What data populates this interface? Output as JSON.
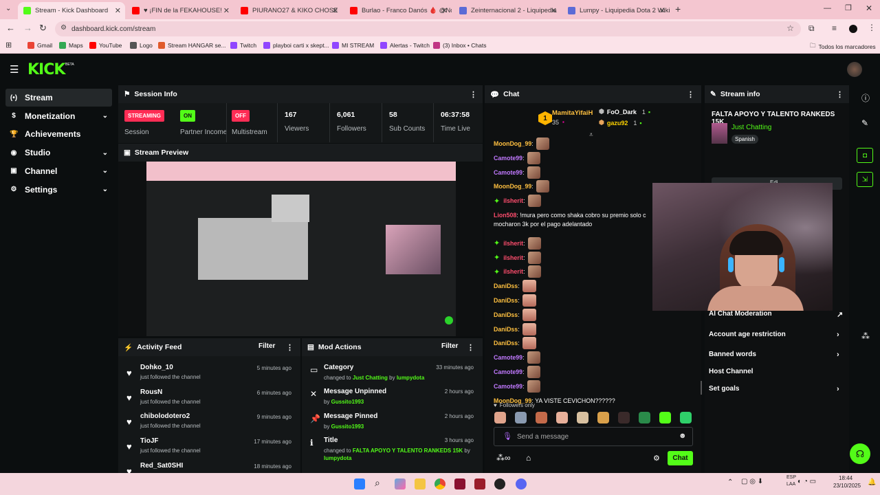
{
  "browser": {
    "tabs": [
      {
        "title": "Stream - Kick Dashboard",
        "color": "#53fc18"
      },
      {
        "title": "♥ ¡FIN de la FEKAHOUSE!",
        "color": "#ff0000"
      },
      {
        "title": "PIURANO27 & KIKO CHOSE",
        "color": "#ff0000"
      },
      {
        "title": "Burlao - Franco Danós 🩸 @Nc",
        "color": "#ff0000"
      },
      {
        "title": "Zeinternacional 2 - Liquipedia",
        "color": "#5b6bd6"
      },
      {
        "title": "Lumpy - Liquipedia Dota 2 Wiki",
        "color": "#5b6bd6"
      }
    ],
    "url": "dashboard.kick.com/stream",
    "bookmarks": [
      {
        "label": "Gmail",
        "color": "#ea4335"
      },
      {
        "label": "Maps",
        "color": "#34a853"
      },
      {
        "label": "YouTube",
        "color": "#ff0000"
      },
      {
        "label": "Logo",
        "color": "#555555"
      },
      {
        "label": "Stream HANGAR se...",
        "color": "#e05a2b"
      },
      {
        "label": "Twitch",
        "color": "#9146ff"
      },
      {
        "label": "playboi carti x skept...",
        "color": "#9146ff"
      },
      {
        "label": "MI STREAM",
        "color": "#9146ff"
      },
      {
        "label": "Alertas - Twitch",
        "color": "#9146ff"
      },
      {
        "label": "(3) Inbox • Chats",
        "color": "#c13584"
      }
    ],
    "all_bookmarks": "Todos los marcadores"
  },
  "brand": {
    "logo": "KICK",
    "beta": "BETA",
    "accent": "#53fc18"
  },
  "sidebar": [
    {
      "label": "Stream",
      "icon": "stream-icon",
      "glyph": "(•)",
      "active": true
    },
    {
      "label": "Monetization",
      "icon": "dollar-icon",
      "glyph": "$",
      "chevron": true
    },
    {
      "label": "Achievements",
      "icon": "trophy-icon",
      "glyph": "🏆"
    },
    {
      "label": "Studio",
      "icon": "studio-icon",
      "glyph": "◉",
      "chevron": true
    },
    {
      "label": "Channel",
      "icon": "channel-icon",
      "glyph": "▣",
      "chevron": true
    },
    {
      "label": "Settings",
      "icon": "gear-icon",
      "glyph": "⚙",
      "chevron": true
    }
  ],
  "session_info": {
    "title": "Session Info",
    "stats": [
      {
        "value": "STREAMING",
        "label": "Session",
        "style": "pill",
        "color": "#ff2d55"
      },
      {
        "value": "ON",
        "label": "Partner Income",
        "style": "pill",
        "color": "#53fc18"
      },
      {
        "value": "OFF",
        "label": "Multistream",
        "style": "pill",
        "color": "#ff2d55"
      },
      {
        "value": "167",
        "label": "Viewers"
      },
      {
        "value": "6,061",
        "label": "Followers"
      },
      {
        "value": "58",
        "label": "Sub Counts"
      },
      {
        "value": "06:37:58",
        "label": "Time Live"
      }
    ]
  },
  "stream_preview": {
    "title": "Stream Preview"
  },
  "activity_feed": {
    "title": "Activity Feed",
    "filter": "Filter",
    "items": [
      {
        "name": "Dohko_10",
        "action": "just followed the channel",
        "time": "5 minutes ago"
      },
      {
        "name": "RousN",
        "action": "just followed the channel",
        "time": "6 minutes ago"
      },
      {
        "name": "chibolodotero2",
        "action": "just followed the channel",
        "time": "9 minutes ago"
      },
      {
        "name": "TioJF",
        "action": "just followed the channel",
        "time": "17 minutes ago"
      },
      {
        "name": "Red_Sat0SHI",
        "action": "",
        "time": "18 minutes ago"
      }
    ]
  },
  "mod_actions": {
    "title": "Mod Actions",
    "filter": "Filter",
    "items": [
      {
        "title": "Category",
        "icon": "category-icon",
        "glyph": "▭",
        "pre": "changed to ",
        "value": "Just Chatting",
        "mid": " by ",
        "by": "lumpydota",
        "time": "33 minutes ago"
      },
      {
        "title": "Message Unpinned",
        "icon": "unpin-icon",
        "glyph": "✕",
        "pre": "",
        "value": "",
        "mid": "by ",
        "by": "Gussito1993",
        "time": "2 hours ago"
      },
      {
        "title": "Message Pinned",
        "icon": "pin-icon",
        "glyph": "📌",
        "pre": "",
        "value": "",
        "mid": "by ",
        "by": "Gussito1993",
        "time": "2 hours ago"
      },
      {
        "title": "Title",
        "icon": "title-icon",
        "glyph": "ℹ",
        "pre": "changed to ",
        "value": "FALTA APOYO Y TALENTO RANKEDS 15K",
        "mid": " by ",
        "by": "lumpydota",
        "time": "3 hours ago"
      }
    ]
  },
  "chat": {
    "title": "Chat",
    "top_gifters": {
      "first": {
        "rank": "1",
        "name": "MamitaYifaiH",
        "count": "35"
      },
      "others": [
        {
          "name": "FoO_Dark",
          "count": "1",
          "color": "#ffffff"
        },
        {
          "name": "gazu92",
          "count": "1",
          "color": "#ffd400"
        }
      ]
    },
    "messages": [
      {
        "user": "MoonDog_99",
        "color": "#ffc040",
        "text": "",
        "emotes": 1,
        "emote": "face"
      },
      {
        "user": "Camote99",
        "color": "#c179ff",
        "text": "",
        "emotes": 1,
        "emote": "face"
      },
      {
        "user": "Camote99",
        "color": "#c179ff",
        "text": "",
        "emotes": 1,
        "emote": "face"
      },
      {
        "user": "MoonDog_99",
        "color": "#ffc040",
        "text": "",
        "emotes": 1,
        "emote": "face"
      },
      {
        "user": "ilsherit",
        "color": "#ff4d6d",
        "text": "",
        "emotes": 1,
        "emote": "face",
        "star": true
      },
      {
        "user": "Lion508",
        "color": "#ff4d6d",
        "text": "!mura pero como shaka cobro su premio solo c",
        "text2": "mocharon 3k por el pago adelantado"
      },
      {
        "user": "ilsherit",
        "color": "#ff4d6d",
        "text": "",
        "emotes": 1,
        "emote": "face",
        "star": true
      },
      {
        "user": "ilsherit",
        "color": "#ff4d6d",
        "text": "",
        "emotes": 1,
        "emote": "face",
        "star": true
      },
      {
        "user": "ilsherit",
        "color": "#ff4d6d",
        "text": "",
        "emotes": 1,
        "emote": "face",
        "star": true
      },
      {
        "user": "DaniDss",
        "color": "#ffc040",
        "text": "",
        "emotes": 1,
        "emote": "hand"
      },
      {
        "user": "DaniDss",
        "color": "#ffc040",
        "text": "",
        "emotes": 1,
        "emote": "hand"
      },
      {
        "user": "DaniDss",
        "color": "#ffc040",
        "text": "",
        "emotes": 1,
        "emote": "hand"
      },
      {
        "user": "DaniDss",
        "color": "#ffc040",
        "text": "",
        "emotes": 1,
        "emote": "hand"
      },
      {
        "user": "DaniDss",
        "color": "#ffc040",
        "text": "",
        "emotes": 1,
        "emote": "hand"
      },
      {
        "user": "Camote99",
        "color": "#c179ff",
        "text": "",
        "emotes": 1,
        "emote": "face"
      },
      {
        "user": "Camote99",
        "color": "#c179ff",
        "text": "",
        "emotes": 1,
        "emote": "face"
      },
      {
        "user": "Camote99",
        "color": "#c179ff",
        "text": "",
        "emotes": 1,
        "emote": "face"
      },
      {
        "user": "MoonDog_99",
        "color": "#ffc040",
        "text": "YA VISTE CEVICHON??????"
      }
    ],
    "followers_only": "Followers only",
    "placeholder": "Send a message",
    "send_label": "Chat"
  },
  "stream_info": {
    "title": "Stream info",
    "stream_title": "FALTA APOYO Y TALENTO RANKEDS 15K",
    "category": "Just Chatting",
    "language": "Spanish",
    "edit_partial": "Edi",
    "settings": [
      {
        "label": "AI Chat Moderation",
        "chevron": "↗"
      },
      {
        "label": "Account age restriction",
        "chevron": "›"
      },
      {
        "label": "Banned words",
        "chevron": "›"
      },
      {
        "label": "Host Channel",
        "chevron": ""
      },
      {
        "label": "Set goals",
        "chevron": "›"
      }
    ]
  },
  "system": {
    "lang": "ESP",
    "lang2": "LAA",
    "time": "18:44",
    "date": "23/10/2025"
  }
}
